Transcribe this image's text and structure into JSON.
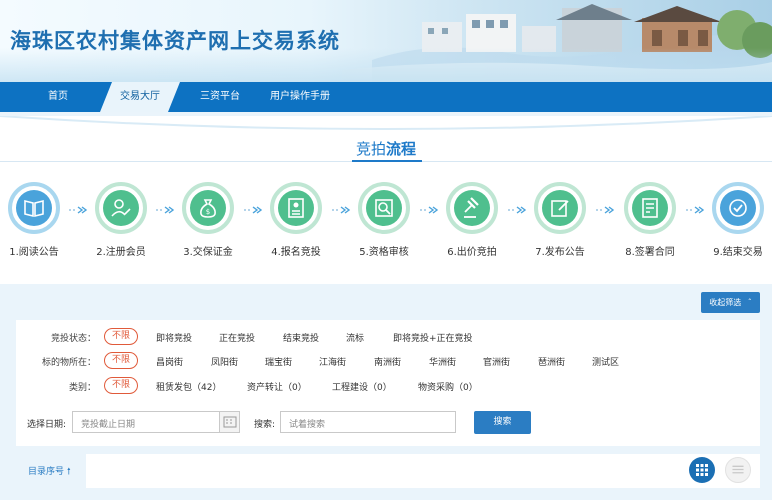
{
  "site": {
    "title": "海珠区农村集体资产网上交易系统"
  },
  "nav": {
    "items": [
      {
        "label": "首页"
      },
      {
        "label": "交易大厅"
      },
      {
        "label": "三资平台"
      },
      {
        "label": "用户操作手册"
      }
    ],
    "active": "交易大厅"
  },
  "process": {
    "title_a": "竞拍",
    "title_b": "流程",
    "steps": [
      {
        "label": "1.阅读公告",
        "icon": "book-icon"
      },
      {
        "label": "2.注册会员",
        "icon": "user-edit-icon"
      },
      {
        "label": "3.交保证金",
        "icon": "money-bag-icon"
      },
      {
        "label": "4.报名竞投",
        "icon": "id-card-icon"
      },
      {
        "label": "5.资格审核",
        "icon": "search-doc-icon"
      },
      {
        "label": "6.出价竞拍",
        "icon": "gavel-icon"
      },
      {
        "label": "7.发布公告",
        "icon": "edit-doc-icon"
      },
      {
        "label": "8.签署合同",
        "icon": "contract-icon"
      },
      {
        "label": "9.结束交易",
        "icon": "check-icon"
      }
    ]
  },
  "filter": {
    "collapse_label": "收起筛选",
    "rows": [
      {
        "label": "竞投状态：",
        "options": [
          "不限",
          "即将竞投",
          "正在竞投",
          "结束竞投",
          "流标",
          "即将竞投+正在竞投"
        ]
      },
      {
        "label": "标的物所在：",
        "options": [
          "不限",
          "昌岗街",
          "凤阳街",
          "瑞宝街",
          "江海街",
          "南洲街",
          "华洲街",
          "官洲街",
          "琶洲街",
          "测试区"
        ]
      },
      {
        "label": "类别：",
        "options": [
          "不限",
          "租赁发包（42）",
          "资产转让（0）",
          "工程建设（0）",
          "物资采购（0）"
        ]
      }
    ],
    "date_label": "选择日期:",
    "date_placeholder": "竞投截止日期",
    "search_label": "搜索:",
    "search_placeholder": "试着搜索",
    "search_button": "搜索"
  },
  "bottom": {
    "catalog_label": "目录序号"
  },
  "colors": {
    "nav": "#0d72c2",
    "green": "#4fbf8e",
    "blue": "#4aa3db",
    "accent": "#e05a3a"
  }
}
